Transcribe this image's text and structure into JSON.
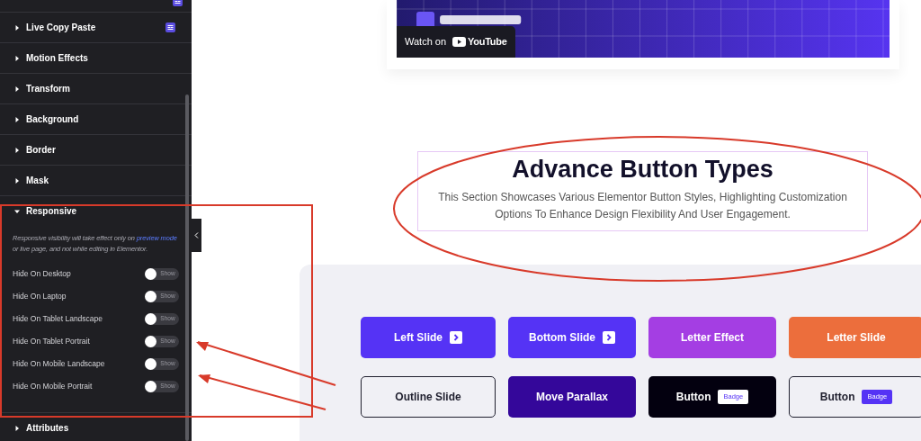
{
  "sidebar": {
    "sections": [
      {
        "label": "Live Copy Paste",
        "expanded": false,
        "pro_badge": true
      },
      {
        "label": "Motion Effects",
        "expanded": false,
        "pro_badge": false
      },
      {
        "label": "Transform",
        "expanded": false,
        "pro_badge": false
      },
      {
        "label": "Background",
        "expanded": false,
        "pro_badge": false
      },
      {
        "label": "Border",
        "expanded": false,
        "pro_badge": false
      },
      {
        "label": "Mask",
        "expanded": false,
        "pro_badge": false
      },
      {
        "label": "Responsive",
        "expanded": true,
        "pro_badge": false,
        "note": "Responsive visibility will take effect only on",
        "note_link": "preview mode",
        "note_end": "or live page, and not while editing in Elementor.",
        "toggles": [
          {
            "label": "Hide On Desktop",
            "on": false,
            "state_text": "Show"
          },
          {
            "label": "Hide On Laptop",
            "on": false,
            "state_text": "Show"
          },
          {
            "label": "Hide On Tablet Landscape",
            "on": false,
            "state_text": "Show"
          },
          {
            "label": "Hide On Tablet Portrait",
            "on": false,
            "state_text": "Show"
          },
          {
            "label": "Hide On Mobile Landscape",
            "on": false,
            "state_text": "Show"
          },
          {
            "label": "Hide On Mobile Portrait",
            "on": false,
            "state_text": "Show"
          }
        ]
      },
      {
        "label": "Attributes",
        "expanded": false,
        "pro_badge": false
      }
    ]
  },
  "video": {
    "kind": "picture",
    "watch_label": "Watch on",
    "platform": "YouTube"
  },
  "heading": {
    "title": "Advance Button Types",
    "subtitle": "This Section Showcases Various Elementor Button Styles, Highlighting Customization Options To Enhance Design Flexibility And User Engagement."
  },
  "buttons": [
    {
      "label": "Left Slide",
      "kind": "filled",
      "color": "#5533f5",
      "icon": true
    },
    {
      "label": "Bottom Slide",
      "kind": "filled",
      "color": "#5533f5",
      "icon": true
    },
    {
      "label": "Letter Effect",
      "kind": "filled",
      "color": "#a43ee3",
      "icon": false
    },
    {
      "label": "Letter Slide",
      "kind": "filled",
      "color": "#ec6e3c",
      "icon": false
    },
    {
      "label": "Outline Slide",
      "kind": "outline",
      "color": "#1f1f2e",
      "icon": false
    },
    {
      "label": "Move Parallax",
      "kind": "filled",
      "color": "#34079a",
      "icon": false
    },
    {
      "label": "Button",
      "kind": "filled",
      "color": "#03000f",
      "icon": false,
      "badge": "Badge"
    },
    {
      "label": "Button",
      "kind": "outline",
      "color": "#1f1f2e",
      "icon": false,
      "badge": "Badge"
    }
  ]
}
